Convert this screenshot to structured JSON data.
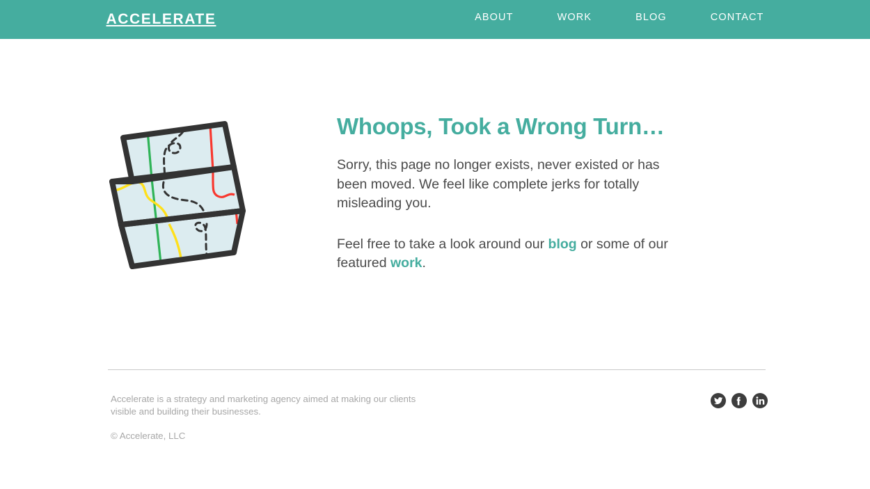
{
  "header": {
    "logo": "ACCELERATE",
    "nav": [
      {
        "label": "ABOUT"
      },
      {
        "label": "WORK"
      },
      {
        "label": "BLOG"
      },
      {
        "label": "CONTACT"
      }
    ],
    "background_color": "#45ad9f"
  },
  "main": {
    "title": "Whoops, Took a Wrong Turn…",
    "paragraph_1": "Sorry, this page no longer exists, never existed or has been moved. We feel like complete jerks for totally misleading you.",
    "paragraph_2_part_1": "Feel free to take a look around our ",
    "link_blog": "blog",
    "paragraph_2_part_2": " or some of our featured ",
    "link_work": "work",
    "paragraph_2_part_3": ".",
    "accent_color": "#45ad9f",
    "body_text_color": "#4a4a4a",
    "illustration": {
      "name": "folded-road-map",
      "paper_fill": "#dcecf0",
      "outline_color": "#333333",
      "road_green": "#2fb457",
      "road_yellow": "#ffe01b",
      "road_red": "#f8382f",
      "route_dashed_color": "#333333"
    }
  },
  "footer": {
    "description": "Accelerate is a strategy and marketing agency aimed at making our clients visible and building their businesses.",
    "copyright": "© Accelerate, LLC",
    "text_color": "#a7a7a7",
    "divider_color": "#c9c9c9",
    "social": [
      {
        "name": "twitter",
        "label": "Twitter"
      },
      {
        "name": "facebook",
        "label": "Facebook"
      },
      {
        "name": "linkedin",
        "label": "LinkedIn"
      }
    ]
  }
}
